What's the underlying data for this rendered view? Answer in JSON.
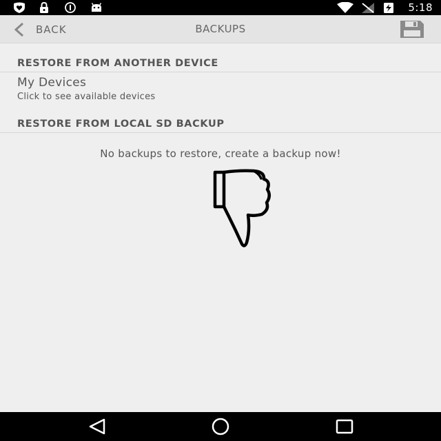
{
  "status_bar": {
    "time": "5:18",
    "left_icons": [
      "heart-shield-icon",
      "lock-icon",
      "circle-info-icon",
      "android-icon"
    ],
    "right_icons": [
      "wifi-icon",
      "signal-off-icon",
      "battery-charging-icon"
    ]
  },
  "app_bar": {
    "back_label": "BACK",
    "title": "BACKUPS",
    "action_icon": "save-icon"
  },
  "sections": {
    "remote_header": "RESTORE FROM ANOTHER DEVICE",
    "local_header": "RESTORE FROM LOCAL SD BACKUP"
  },
  "devices_item": {
    "title": "My Devices",
    "subtitle": "Click to see available devices"
  },
  "empty_state": {
    "message": "No backups to restore, create a backup now!",
    "icon": "thumbs-down-icon"
  },
  "nav_bar": {
    "buttons": [
      "back-triangle-icon",
      "home-circle-icon",
      "recents-square-icon"
    ]
  },
  "colors": {
    "background": "#efefef",
    "app_bar": "#e4e4e4",
    "system_bars": "#000000",
    "text": "#555555"
  }
}
